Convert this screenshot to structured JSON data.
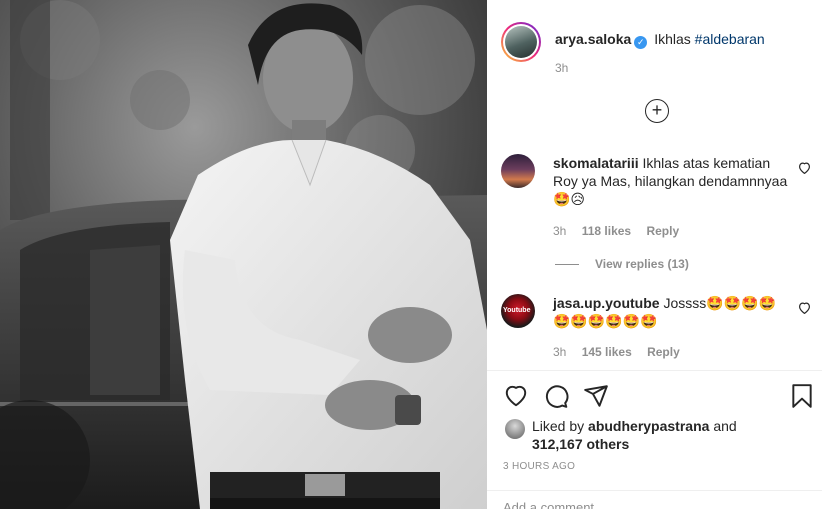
{
  "post": {
    "author": "arya.saloka",
    "verified_icon": "verified-badge-icon",
    "caption_text": "Ikhlas",
    "hashtag": "#aldebaran",
    "time_ago": "3h"
  },
  "comments": [
    {
      "user": "skomalatariii",
      "text": "Ikhlas atas kematian Roy ya Mas, hilangkan dendamnnyaa",
      "emoji": "🤩😥",
      "time": "3h",
      "likes": "118 likes",
      "reply_label": "Reply",
      "view_replies": "View replies (13)"
    },
    {
      "user": "jasa.up.youtube",
      "text": "Jossss",
      "emoji": "🤩🤩🤩🤩🤩🤩🤩🤩🤩🤩",
      "time": "3h",
      "likes": "145 likes",
      "reply_label": "Reply"
    }
  ],
  "likes": {
    "prefix": "Liked by",
    "user": "abudherypastrana",
    "joiner": "and",
    "others": "312,167 others"
  },
  "timestamp": "3 HOURS AGO",
  "add_comment_placeholder": "Add a comment...",
  "colors": {
    "link": "#00376b",
    "muted": "#8e8e8e",
    "text": "#262626",
    "verified": "#3897f0"
  },
  "icons": [
    "heart-icon",
    "comment-icon",
    "share-icon",
    "save-icon",
    "add-circle-icon",
    "verified-badge-icon"
  ]
}
